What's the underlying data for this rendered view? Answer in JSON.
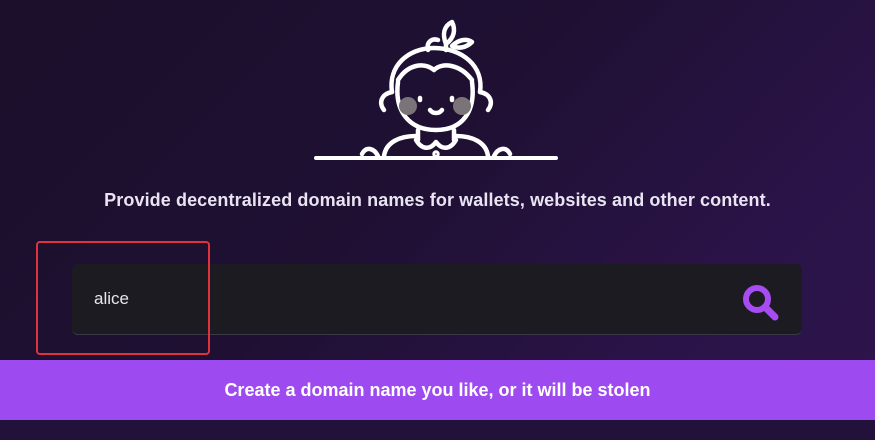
{
  "hero": {
    "illustration": "girl-avatar-icon"
  },
  "tagline": "Provide decentralized domain names for wallets, websites and other content.",
  "search": {
    "value": "alice",
    "icon": "search-icon"
  },
  "banner": {
    "text": "Create a domain name you like, or it will be stolen"
  },
  "colors": {
    "accent": "#9d4bf0",
    "search_icon": "#a64cf2",
    "highlight": "#e0323d",
    "background": "#1f1033"
  }
}
